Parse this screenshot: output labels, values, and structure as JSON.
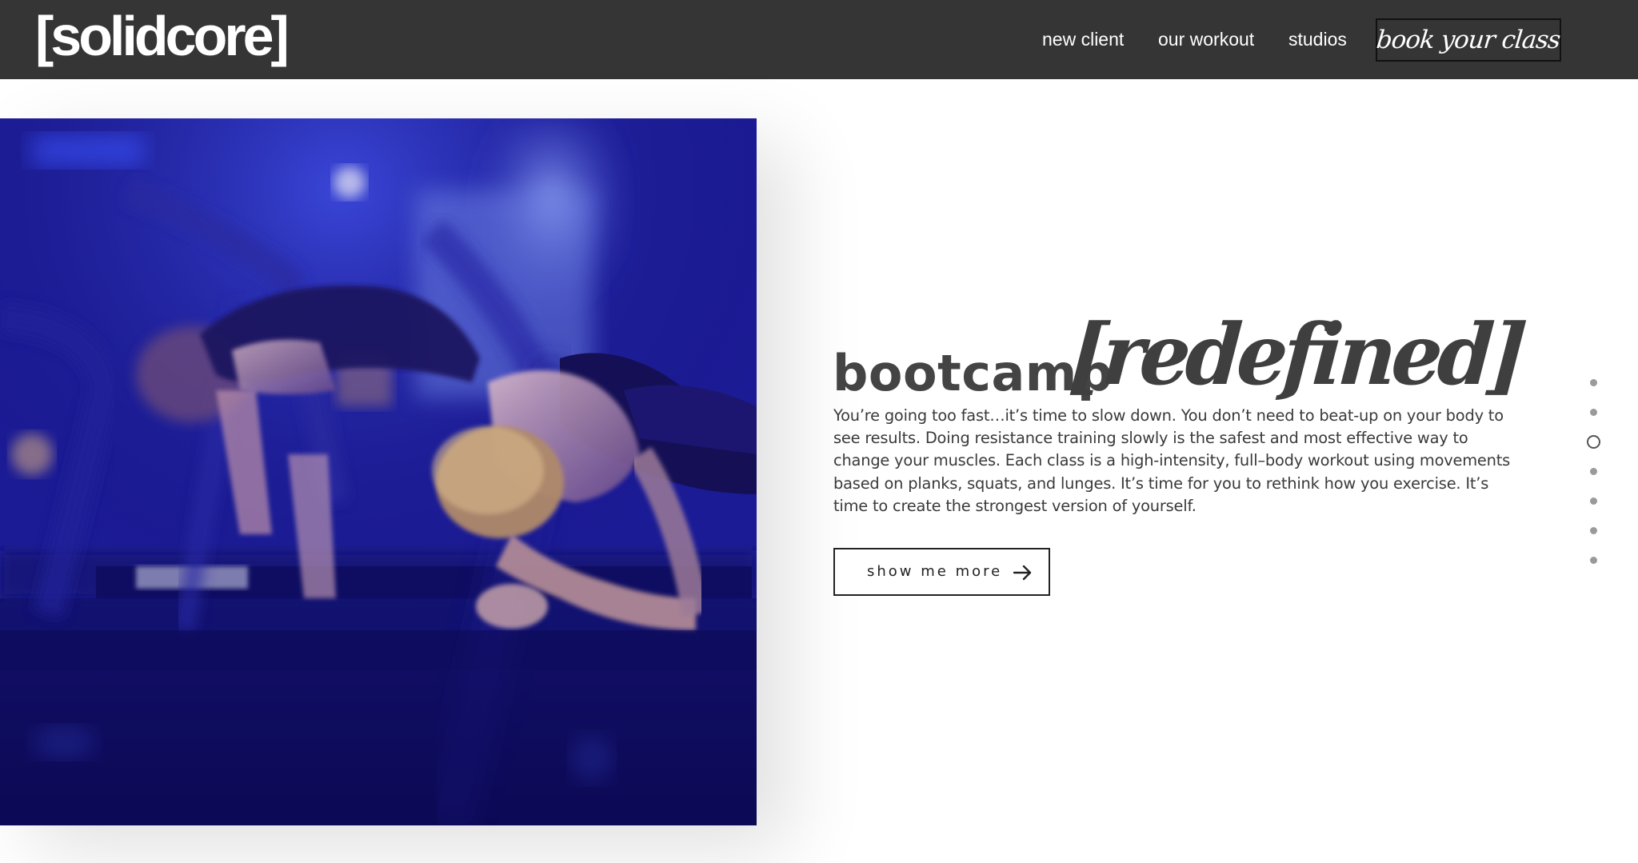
{
  "header": {
    "logo": "[solidcore]",
    "nav": [
      {
        "label": "new client"
      },
      {
        "label": "our workout"
      },
      {
        "label": "studios"
      }
    ],
    "cta_label": "book your class"
  },
  "hero": {
    "image_alt": "",
    "headline_main": "bootcamp",
    "headline_accent": "[redefined]",
    "body": "You’re going too fast…it’s time to slow down. You don’t need to beat-up on your body to see results. Doing resistance training slowly is the safest and most effective way to change your muscles. Each class is a high-intensity, full–body workout using movements based on planks, squats, and lunges. It’s time for you to rethink how you exercise. It’s time to create the strongest version of yourself.",
    "button_label": "show me more"
  },
  "section_nav": {
    "count": 7,
    "active_index": 2
  },
  "colors": {
    "header_bg": "#353535",
    "hero_tint": "#15117a",
    "text": "#3a3a3a"
  }
}
